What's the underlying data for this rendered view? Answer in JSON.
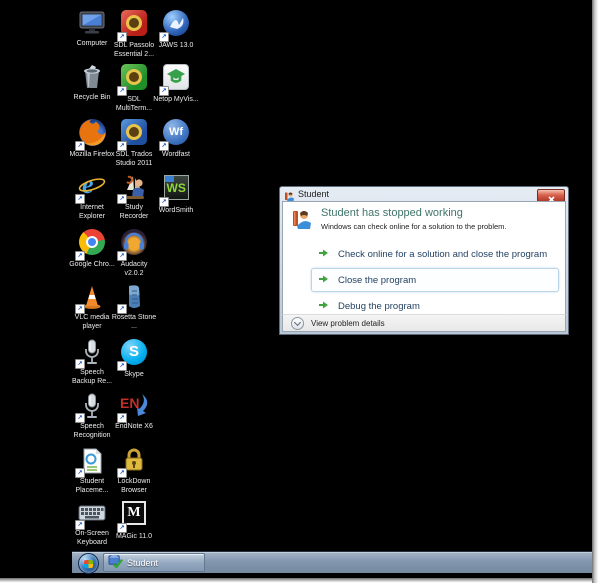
{
  "desktop": {
    "background_color": "#000000",
    "icons": [
      {
        "label": "Computer",
        "glyph": "computer",
        "col": 0,
        "row": 0,
        "shortcut": false
      },
      {
        "label": "SDL Passolo Essential 2...",
        "glyph": "sdl-passolo",
        "col": 1,
        "row": 0,
        "shortcut": true
      },
      {
        "label": "JAWS 13.0",
        "glyph": "jaws",
        "col": 2,
        "row": 0,
        "shortcut": true
      },
      {
        "label": "Recycle Bin",
        "glyph": "recycle-bin",
        "col": 0,
        "row": 1,
        "shortcut": false
      },
      {
        "label": "SDL MultiTerm...",
        "glyph": "sdl-multiterm",
        "col": 1,
        "row": 1,
        "shortcut": true
      },
      {
        "label": "Netop MyVis...",
        "glyph": "netop",
        "col": 2,
        "row": 1,
        "shortcut": true
      },
      {
        "label": "Mozilla Firefox",
        "glyph": "firefox",
        "col": 0,
        "row": 2,
        "shortcut": true
      },
      {
        "label": "SDL Trados Studio 2011",
        "glyph": "sdl-trados",
        "col": 1,
        "row": 2,
        "shortcut": true
      },
      {
        "label": "Wordfast",
        "glyph": "wordfast",
        "col": 2,
        "row": 2,
        "shortcut": true
      },
      {
        "label": "Internet Explorer",
        "glyph": "internet-explorer",
        "col": 0,
        "row": 3,
        "shortcut": true
      },
      {
        "label": "Study Recorder",
        "glyph": "study-recorder",
        "col": 1,
        "row": 3,
        "shortcut": true
      },
      {
        "label": "WordSmith",
        "glyph": "wordsmith",
        "col": 2,
        "row": 3,
        "shortcut": true
      },
      {
        "label": "Google Chro...",
        "glyph": "chrome",
        "col": 0,
        "row": 4,
        "shortcut": true
      },
      {
        "label": "Audacity v2.0.2",
        "glyph": "audacity",
        "col": 1,
        "row": 4,
        "shortcut": true
      },
      {
        "label": "VLC media player",
        "glyph": "vlc",
        "col": 0,
        "row": 5,
        "shortcut": true
      },
      {
        "label": "Rosetta Stone ...",
        "glyph": "rosetta",
        "col": 1,
        "row": 5,
        "shortcut": true
      },
      {
        "label": "Speech Backup Re...",
        "glyph": "microphone",
        "col": 0,
        "row": 6,
        "shortcut": true
      },
      {
        "label": "Skype",
        "glyph": "skype",
        "col": 1,
        "row": 6,
        "shortcut": true
      },
      {
        "label": "Speech Recognition",
        "glyph": "microphone",
        "col": 0,
        "row": 7,
        "shortcut": true
      },
      {
        "label": "EndNote X6",
        "glyph": "endnote",
        "col": 1,
        "row": 7,
        "shortcut": true
      },
      {
        "label": "Student Placeme...",
        "glyph": "student-placement",
        "col": 0,
        "row": 8,
        "shortcut": true
      },
      {
        "label": "LockDown Browser",
        "glyph": "lockdown",
        "col": 1,
        "row": 8,
        "shortcut": true
      },
      {
        "label": "On-Screen Keyboard",
        "glyph": "osk",
        "col": 0,
        "row": 9,
        "shortcut": true
      },
      {
        "label": "MAGic 11.0",
        "glyph": "magic",
        "col": 1,
        "row": 9,
        "shortcut": true
      }
    ]
  },
  "dialog": {
    "title": "Student",
    "header": "Student has stopped working",
    "message": "Windows can check online for a solution to the problem.",
    "options": [
      {
        "label": "Check online for a solution and close the program",
        "focused": false
      },
      {
        "label": "Close the program",
        "focused": true
      },
      {
        "label": "Debug the program",
        "focused": false
      }
    ],
    "details_label": "View problem details"
  },
  "taskbar": {
    "buttons": [
      {
        "label": "Student"
      }
    ]
  },
  "colors": {
    "header_text": "#3e7468",
    "command_link_text": "#1f3e5f",
    "command_arrow": "#3fa43f",
    "taskbar": "#8296ae",
    "close_button": "#c24a38"
  }
}
